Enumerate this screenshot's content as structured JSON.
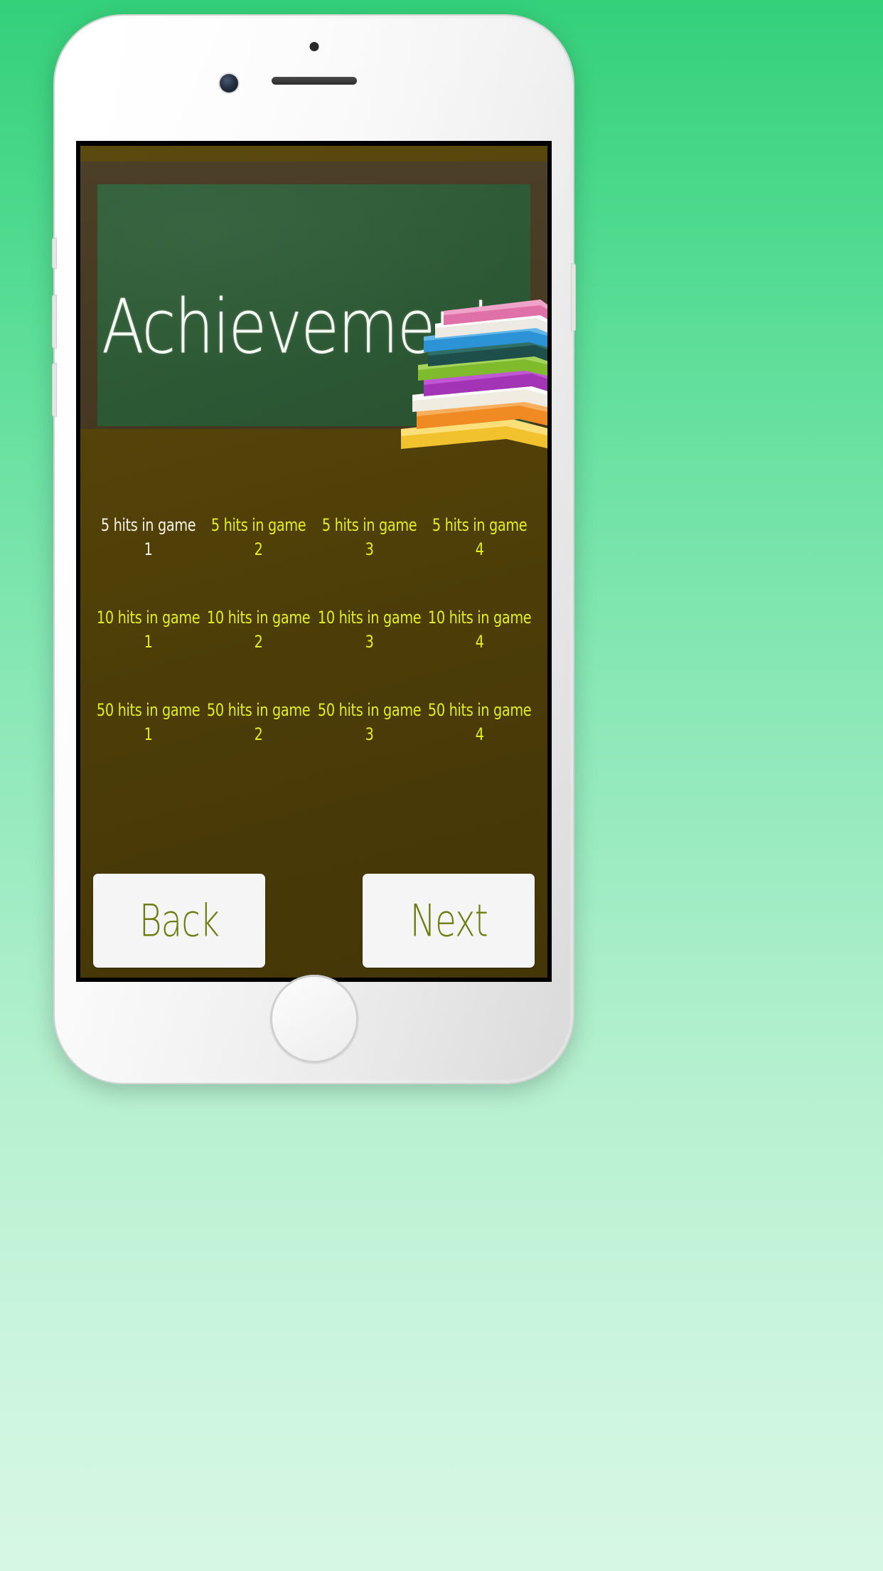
{
  "device": {
    "name": "white-smartphone-mockup",
    "elements": [
      "proximity-sensor",
      "front-camera",
      "speaker-grille",
      "home-button",
      "volume-up-button",
      "volume-down-button",
      "silent-switch",
      "power-button"
    ]
  },
  "screen": {
    "background_color": "#4c3d08",
    "border_color": "#000000"
  },
  "board": {
    "title": "Achievements",
    "board_color": "#2e5a35",
    "frame_color": "#453821",
    "title_color": "#f4faf2",
    "decoration": "stack-of-books-illustration"
  },
  "achievements": {
    "earned_color": "#f6f3e4",
    "locked_color": "#e2ee1f",
    "rows": [
      {
        "id": "row-5-hits",
        "cells": [
          {
            "label": "5 hits in game\n1",
            "earned": true
          },
          {
            "label": "5 hits in game\n2",
            "earned": false
          },
          {
            "label": "5 hits in game\n3",
            "earned": false
          },
          {
            "label": "5 hits in game\n4",
            "earned": false
          }
        ]
      },
      {
        "id": "row-10-hits",
        "cells": [
          {
            "label": "10 hits in game\n1",
            "earned": false
          },
          {
            "label": "10 hits in game\n2",
            "earned": false
          },
          {
            "label": "10 hits in game\n3",
            "earned": false
          },
          {
            "label": "10 hits in game\n4",
            "earned": false
          }
        ]
      },
      {
        "id": "row-50-hits",
        "cells": [
          {
            "label": "50 hits in game\n1",
            "earned": false
          },
          {
            "label": "50 hits in game\n2",
            "earned": false
          },
          {
            "label": "50 hits in game\n3",
            "earned": false
          },
          {
            "label": "50 hits in game\n4",
            "earned": false
          }
        ]
      }
    ]
  },
  "nav": {
    "back_label": "Back",
    "next_label": "Next",
    "button_bg": "#f5f5f5",
    "button_text_color": "#6e7d11"
  },
  "page_background": {
    "top_color": "#34d07a",
    "bottom_color": "#d6f7e4"
  }
}
